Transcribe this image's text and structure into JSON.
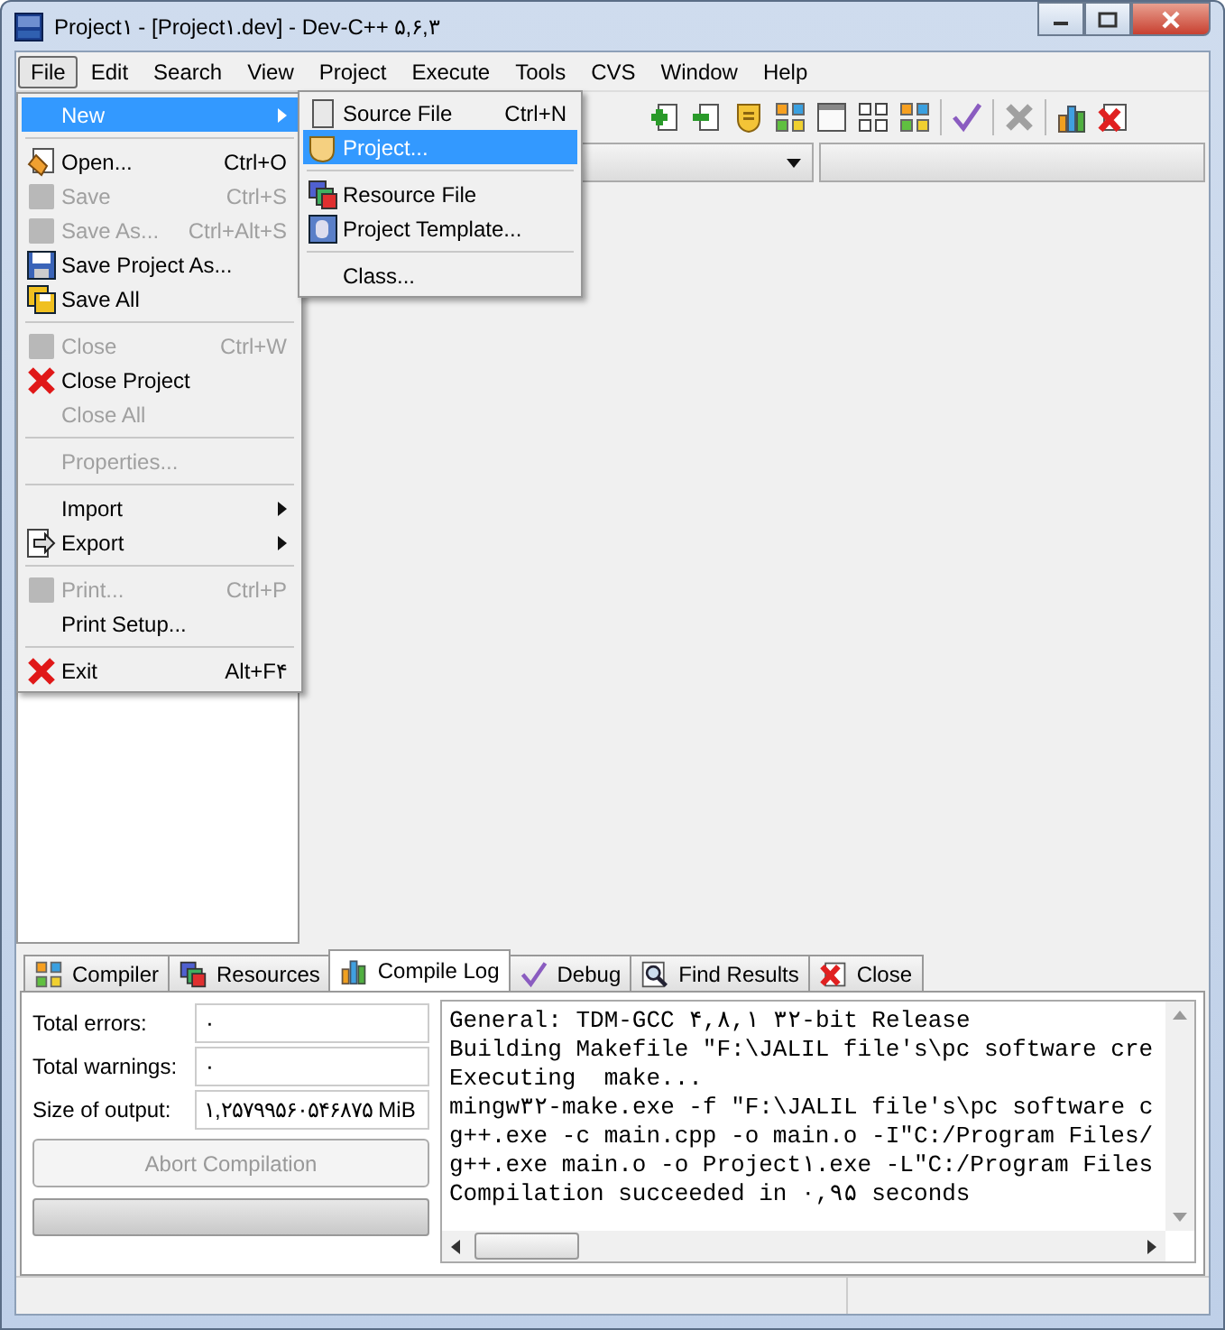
{
  "window": {
    "title": "Project۱ - [Project۱.dev] - Dev-C++ ۵,۶,۳"
  },
  "menu_bar": [
    {
      "label": "File",
      "selected": true
    },
    {
      "label": "Edit",
      "selected": false
    },
    {
      "label": "Search",
      "selected": false
    },
    {
      "label": "View",
      "selected": false
    },
    {
      "label": "Project",
      "selected": false
    },
    {
      "label": "Execute",
      "selected": false
    },
    {
      "label": "Tools",
      "selected": false
    },
    {
      "label": "CVS",
      "selected": false
    },
    {
      "label": "Window",
      "selected": false
    },
    {
      "label": "Help",
      "selected": false
    }
  ],
  "file_menu": [
    {
      "kind": "item",
      "label": "New",
      "submenu": true,
      "disabled": false,
      "selected": true
    },
    {
      "kind": "separator"
    },
    {
      "kind": "item",
      "label": "Open...",
      "shortcut": "Ctrl+O",
      "submenu": false,
      "disabled": false,
      "selected": false
    },
    {
      "kind": "item",
      "label": "Save",
      "shortcut": "Ctrl+S",
      "submenu": false,
      "disabled": true,
      "selected": false
    },
    {
      "kind": "item",
      "label": "Save As...",
      "shortcut": "Ctrl+Alt+S",
      "submenu": false,
      "disabled": true,
      "selected": false
    },
    {
      "kind": "item",
      "label": "Save Project As...",
      "submenu": false,
      "disabled": false,
      "selected": false
    },
    {
      "kind": "item",
      "label": "Save All",
      "submenu": false,
      "disabled": false,
      "selected": false
    },
    {
      "kind": "separator"
    },
    {
      "kind": "item",
      "label": "Close",
      "shortcut": "Ctrl+W",
      "submenu": false,
      "disabled": true,
      "selected": false
    },
    {
      "kind": "item",
      "label": "Close Project",
      "submenu": false,
      "disabled": false,
      "selected": false
    },
    {
      "kind": "item",
      "label": "Close All",
      "submenu": false,
      "disabled": true,
      "selected": false
    },
    {
      "kind": "separator"
    },
    {
      "kind": "item",
      "label": "Properties...",
      "submenu": false,
      "disabled": true,
      "selected": false
    },
    {
      "kind": "separator"
    },
    {
      "kind": "item",
      "label": "Import",
      "submenu": true,
      "disabled": false,
      "selected": false
    },
    {
      "kind": "item",
      "label": "Export",
      "submenu": true,
      "disabled": false,
      "selected": false
    },
    {
      "kind": "separator"
    },
    {
      "kind": "item",
      "label": "Print...",
      "shortcut": "Ctrl+P",
      "submenu": false,
      "disabled": true,
      "selected": false
    },
    {
      "kind": "item",
      "label": "Print Setup...",
      "submenu": false,
      "disabled": false,
      "selected": false
    },
    {
      "kind": "separator"
    },
    {
      "kind": "item",
      "label": "Exit",
      "shortcut": "Alt+F۴",
      "submenu": false,
      "disabled": false,
      "selected": false
    }
  ],
  "new_submenu": [
    {
      "kind": "item",
      "label": "Source File",
      "shortcut": "Ctrl+N",
      "selected": false
    },
    {
      "kind": "item",
      "label": "Project...",
      "selected": true
    },
    {
      "kind": "separator"
    },
    {
      "kind": "item",
      "label": "Resource File",
      "selected": false
    },
    {
      "kind": "item",
      "label": "Project Template...",
      "selected": false
    },
    {
      "kind": "separator"
    },
    {
      "kind": "item",
      "label": "Class...",
      "selected": false
    }
  ],
  "bottom_tabs": [
    {
      "label": "Compiler",
      "selected": false
    },
    {
      "label": "Resources",
      "selected": false
    },
    {
      "label": "Compile Log",
      "selected": true
    },
    {
      "label": "Debug",
      "selected": false
    },
    {
      "label": "Find Results",
      "selected": false
    },
    {
      "label": "Close",
      "selected": false
    }
  ],
  "compile_stats": [
    {
      "label": "Total errors:",
      "value": "۰"
    },
    {
      "label": "Total warnings:",
      "value": "۰"
    },
    {
      "label": "Size of output:",
      "value": "۱,۲۵۷۹۹۵۶۰۵۴۶۸۷۵ MiB"
    }
  ],
  "abort_button": {
    "label": "Abort Compilation",
    "disabled": true
  },
  "progress": {
    "level": 0
  },
  "compile_log": [
    "General: TDM-GCC ۴,۸,۱ ۳۲-bit Release",
    "Building Makefile \"F:\\JALIL file's\\pc software cre",
    "Executing  make...",
    "mingw۳۲-make.exe -f \"F:\\JALIL file's\\pc software c",
    "g++.exe -c main.cpp -o main.o -I\"C:/Program Files/",
    "g++.exe main.o -o Project۱.exe -L\"C:/Program Files",
    "Compilation succeeded in ۰,۹۵ seconds"
  ]
}
